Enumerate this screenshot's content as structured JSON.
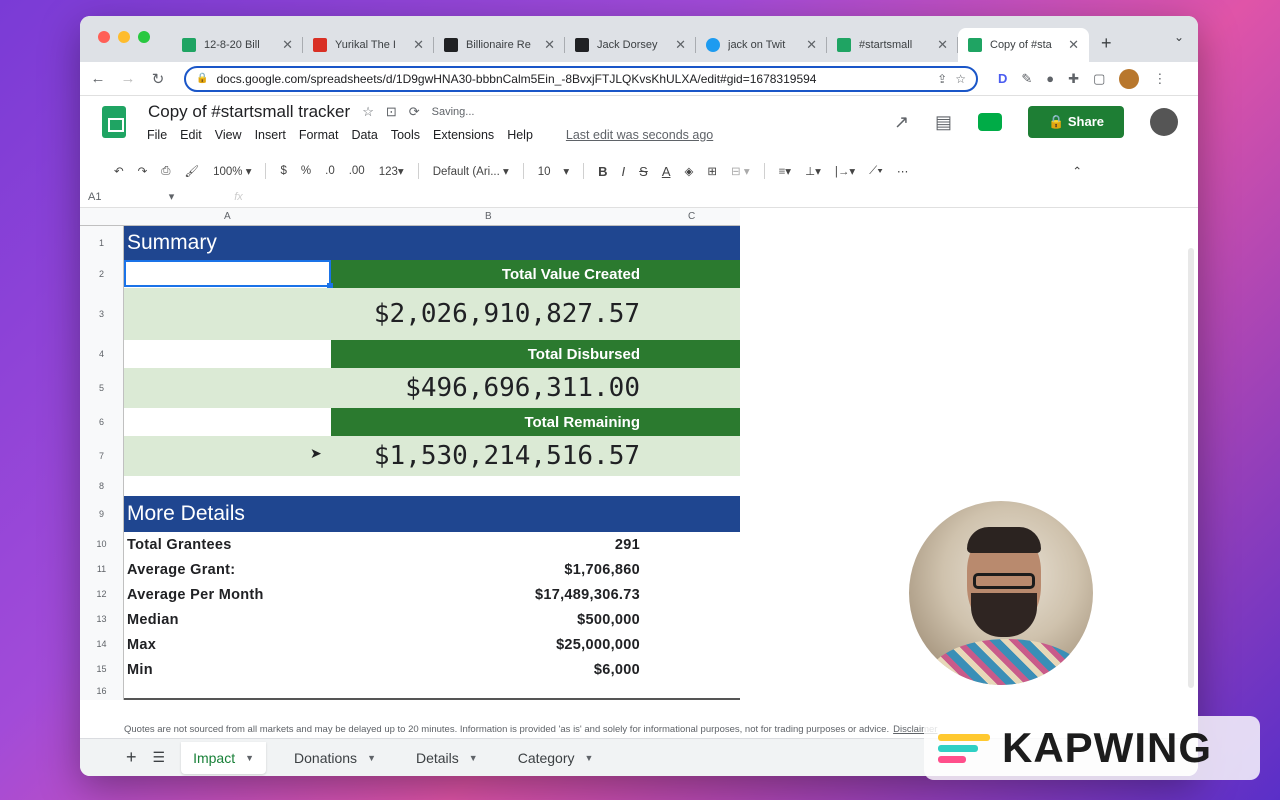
{
  "browser": {
    "tabs": [
      {
        "title": "12-8-20 Bill",
        "favicon_color": "#1fa463"
      },
      {
        "title": "Yurikal The I",
        "favicon_color": "#d93025"
      },
      {
        "title": "Billionaire Re",
        "favicon_color": "#202124"
      },
      {
        "title": "Jack Dorsey",
        "favicon_color": "#202124"
      },
      {
        "title": "jack on Twit",
        "favicon_color": "#1d9bf0"
      },
      {
        "title": "#startsmall",
        "favicon_color": "#1fa463"
      },
      {
        "title": "Copy of #sta",
        "favicon_color": "#1fa463",
        "active": true
      }
    ],
    "url": "docs.google.com/spreadsheets/d/1D9gwHNA30-bbbnCalm5Ein_-8BvxjFTJLQKvsKhULXA/edit#gid=1678319594"
  },
  "sheets": {
    "title": "Copy of #startsmall tracker",
    "saving": "Saving...",
    "menus": [
      "File",
      "Edit",
      "View",
      "Insert",
      "Format",
      "Data",
      "Tools",
      "Extensions",
      "Help"
    ],
    "last_edit": "Last edit was seconds ago",
    "share_label": "Share",
    "toolbar": {
      "zoom": "100%",
      "currency": "$",
      "percent": "%",
      "dec_less": ".0",
      "dec_more": ".00",
      "num_format": "123",
      "font": "Default (Ari...",
      "font_size": "10"
    },
    "cell_ref": "A1",
    "fx": "fx",
    "columns": [
      "A",
      "B",
      "C"
    ],
    "rows": [
      "1",
      "2",
      "3",
      "4",
      "5",
      "6",
      "7",
      "8",
      "9",
      "10",
      "11",
      "12",
      "13",
      "14",
      "15",
      "16"
    ]
  },
  "content": {
    "summary_title": "Summary",
    "total_value_label": "Total Value Created",
    "total_value": "$2,026,910,827.57",
    "total_disbursed_label": "Total Disbursed",
    "total_disbursed": "$496,696,311.00",
    "total_remaining_label": "Total Remaining",
    "total_remaining": "$1,530,214,516.57",
    "details_title": "More Details",
    "details": [
      {
        "label": "Total Grantees",
        "value": "291"
      },
      {
        "label": "Average Grant:",
        "value": "$1,706,860"
      },
      {
        "label": "Average Per Month",
        "value": "$17,489,306.73"
      },
      {
        "label": "Median",
        "value": "$500,000"
      },
      {
        "label": "Max",
        "value": "$25,000,000"
      },
      {
        "label": "Min",
        "value": "$6,000"
      }
    ],
    "disclaimer": "Quotes are not sourced from all markets and may be delayed up to 20 minutes. Information is provided 'as is' and solely for informational purposes, not for trading purposes or advice.",
    "disclaimer_link": "Disclaimer"
  },
  "sheet_tabs": [
    "Impact",
    "Donations",
    "Details",
    "Category"
  ],
  "watermark": {
    "text": "KAPWING",
    "colors": [
      "#ffc930",
      "#2fd0c4",
      "#ff4f8b"
    ]
  }
}
